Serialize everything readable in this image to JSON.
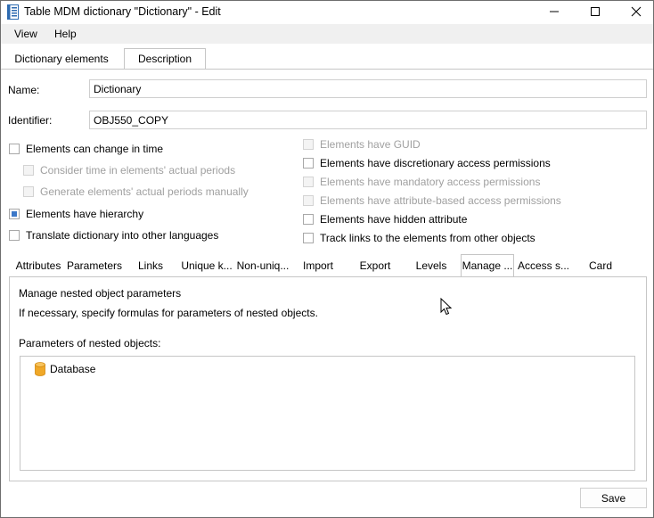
{
  "window": {
    "title": "Table MDM dictionary \"Dictionary\" - Edit",
    "controls": {
      "minimize_icon": "minimize-icon",
      "maximize_icon": "maximize-icon",
      "close_icon": "close-icon"
    }
  },
  "menu": {
    "items": [
      "View",
      "Help"
    ]
  },
  "top_tabs": {
    "items": [
      "Dictionary elements",
      "Description"
    ],
    "active": "Description"
  },
  "form": {
    "name_label": "Name:",
    "name_value": "Dictionary",
    "identifier_label": "Identifier:",
    "identifier_value": "OBJ550_COPY"
  },
  "options_left": [
    {
      "label": "Elements can change in time",
      "checked": false,
      "enabled": true
    },
    {
      "label": "Consider time in elements' actual periods",
      "checked": false,
      "enabled": false
    },
    {
      "label": "Generate elements' actual periods manually",
      "checked": false,
      "enabled": false
    },
    {
      "label": "Elements have hierarchy",
      "checked": true,
      "enabled": true
    },
    {
      "label": "Translate dictionary into other languages",
      "checked": false,
      "enabled": true
    }
  ],
  "options_right": [
    {
      "label": "Elements have GUID",
      "checked": false,
      "enabled": false
    },
    {
      "label": "Elements have discretionary access permissions",
      "checked": false,
      "enabled": true
    },
    {
      "label": "Elements have mandatory access permissions",
      "checked": false,
      "enabled": false
    },
    {
      "label": "Elements have attribute-based access permissions",
      "checked": false,
      "enabled": false
    },
    {
      "label": "Elements have hidden attribute",
      "checked": false,
      "enabled": true
    },
    {
      "label": "Track links to the elements from other objects",
      "checked": false,
      "enabled": true
    }
  ],
  "inner_tabs": {
    "items": [
      "Attributes",
      "Parameters",
      "Links",
      "Unique k...",
      "Non-uniq...",
      "Import",
      "Export",
      "Levels",
      "Manage ...",
      "Access s...",
      "Card"
    ],
    "active": "Manage ..."
  },
  "panel": {
    "heading": "Manage nested object parameters",
    "hint": "If necessary, specify formulas for parameters of nested objects.",
    "tree_label": "Parameters of nested objects:",
    "tree_items": [
      {
        "label": "Database",
        "icon": "database-icon",
        "icon_color": "#f0a828"
      }
    ]
  },
  "footer": {
    "save_label": "Save"
  },
  "colors": {
    "accent": "#3c78c8",
    "border": "#c6c6c6",
    "menubar_bg": "#f0f0f0"
  }
}
